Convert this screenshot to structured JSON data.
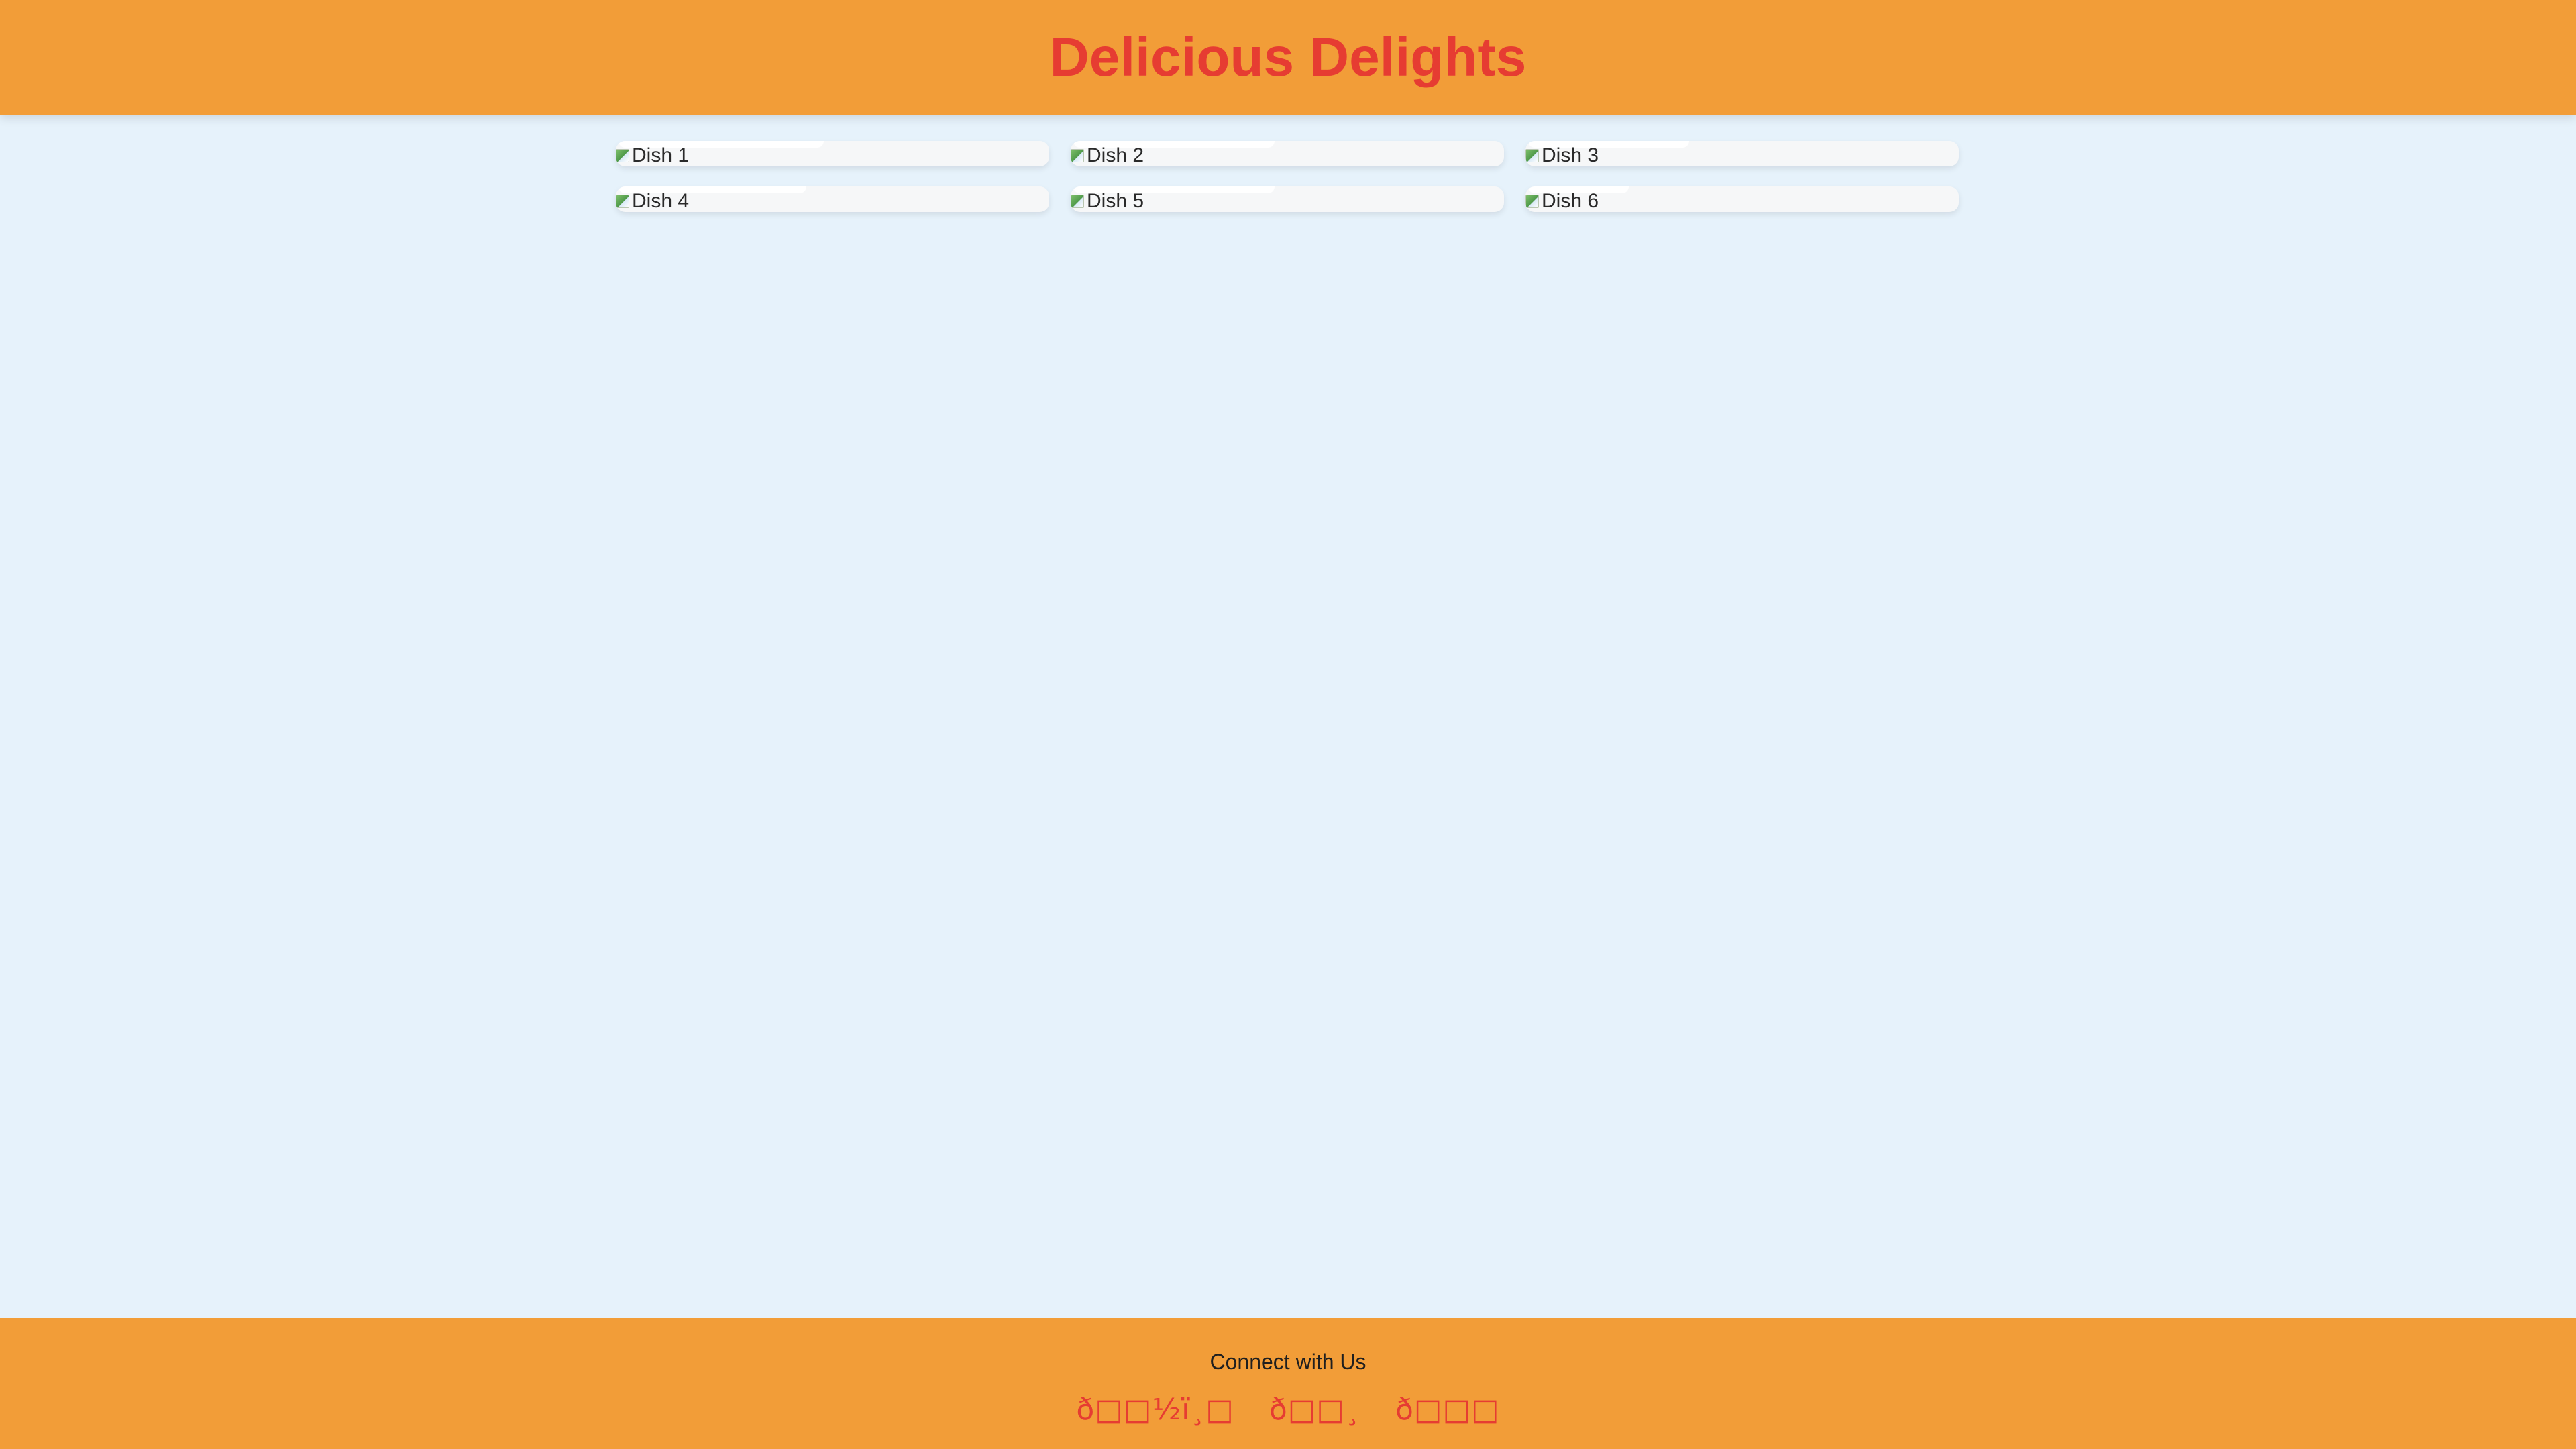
{
  "header": {
    "title": "Delicious Delights"
  },
  "gallery": {
    "dishes": [
      {
        "alt": "Dish 1"
      },
      {
        "alt": "Dish 2"
      },
      {
        "alt": "Dish 3"
      },
      {
        "alt": "Dish 4"
      },
      {
        "alt": "Dish 5"
      },
      {
        "alt": "Dish 6"
      }
    ]
  },
  "footer": {
    "heading": "Connect with Us",
    "social_links": [
      {
        "label": "ð·ï¸",
        "display": "ð□□½ï¸□"
      },
      {
        "label": "ð¦",
        "display": "ð□□¸"
      },
      {
        "label": "ð",
        "display": "ð□□□"
      }
    ]
  },
  "colors": {
    "header_bg": "#f29d38",
    "title": "#e63c32",
    "page_bg": "#e6f2fb",
    "card_bg": "#f6f7f8",
    "footer_bg": "#f29d38",
    "social_link": "#e63c32"
  }
}
